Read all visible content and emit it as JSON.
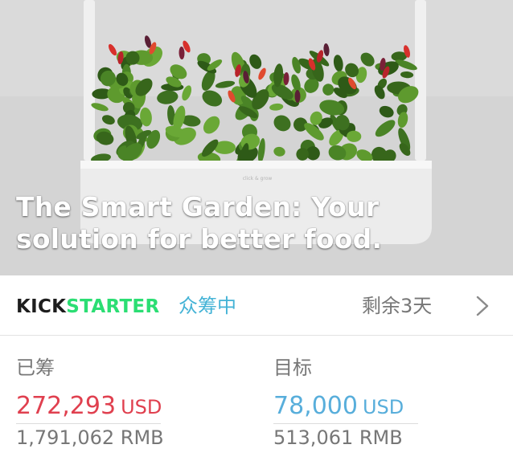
{
  "hero": {
    "title": "The Smart Garden: Your solution for better food.",
    "planter_brand": "click & grow"
  },
  "platform": {
    "brand_prefix": "KICK",
    "brand_suffix": "STARTER",
    "status": "众筹中",
    "days_left": "剩余3天",
    "colors": {
      "brand_green": "#2bde73",
      "status_blue": "#44b3d6"
    }
  },
  "stats": {
    "raised": {
      "label": "已筹",
      "amount": "272,293",
      "unit": "USD",
      "converted": "1,791,062 RMB",
      "color": "#e0404f"
    },
    "goal": {
      "label": "目标",
      "amount": "78,000",
      "unit": "USD",
      "converted": "513,061 RMB",
      "color": "#58aedb"
    }
  }
}
